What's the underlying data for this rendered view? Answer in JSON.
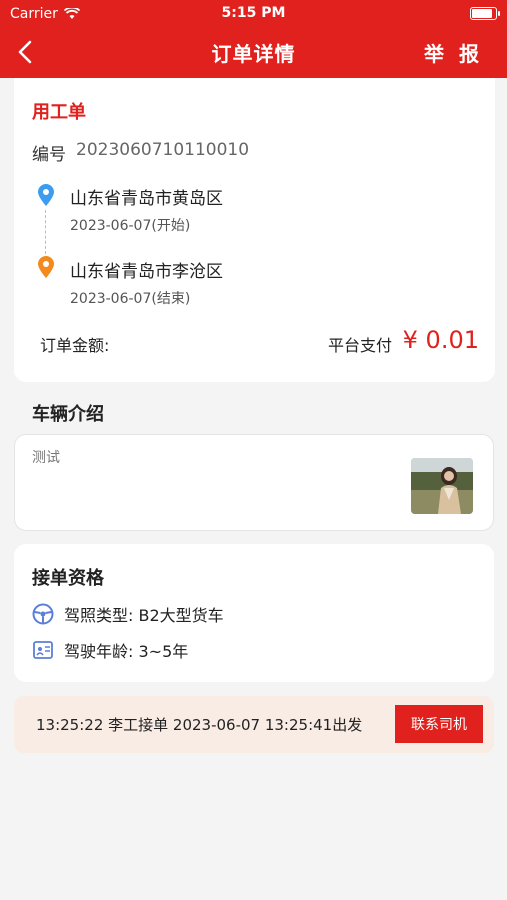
{
  "status_bar": {
    "carrier": "Carrier",
    "time": "5:15 PM",
    "battery_level": 0.9
  },
  "nav": {
    "title": "订单详情",
    "report_label": "举 报"
  },
  "order": {
    "section_title": "用工单",
    "number_label": "编号",
    "number_value": "2023060710110010",
    "start": {
      "place": "山东省青岛市黄岛区",
      "date": "2023-06-07(开始)"
    },
    "end": {
      "place": "山东省青岛市李沧区",
      "date": "2023-06-07(结束)"
    },
    "amount_label": "订单金额:",
    "payment_method": "平台支付",
    "amount_value": "¥ 0.01"
  },
  "vehicle": {
    "section_title": "车辆介绍",
    "description": "测试"
  },
  "qualification": {
    "section_title": "接单资格",
    "license": "驾照类型:  B2大型货车",
    "driving_years": "驾驶年龄:  3~5年"
  },
  "accept_status": {
    "text": "13:25:22 李工接单  2023-06-07 13:25:41出发",
    "contact_label": "联系司机"
  },
  "colors": {
    "brand": "#e0211d",
    "start_pin": "#3b9cf0",
    "end_pin": "#f28a1e",
    "icon_blue": "#5b7fd6"
  }
}
